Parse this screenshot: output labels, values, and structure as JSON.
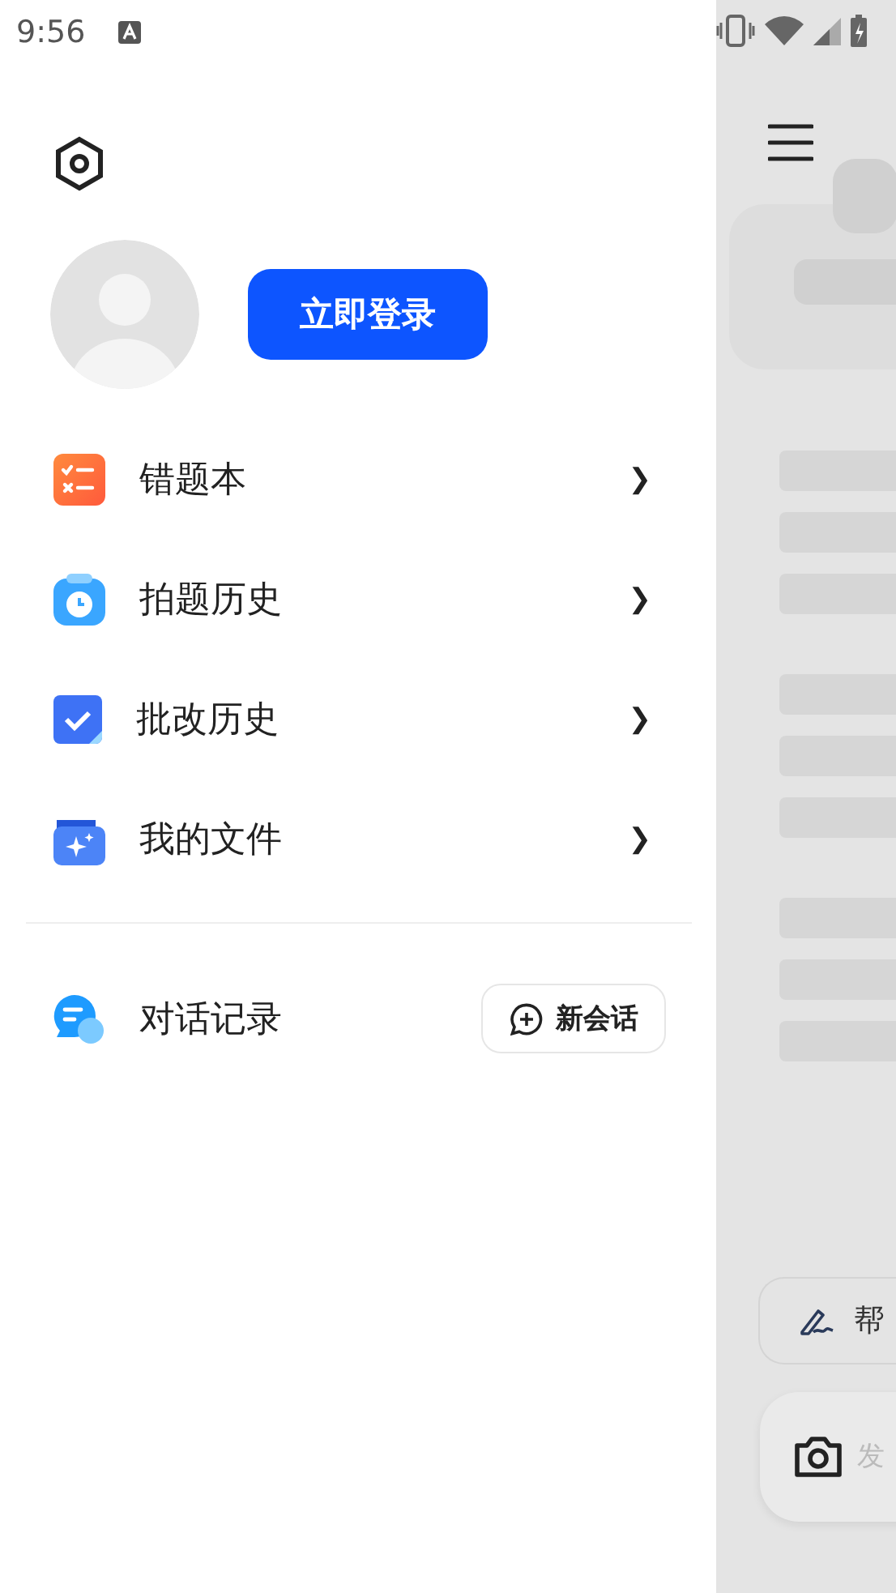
{
  "status_bar": {
    "time": "9:56"
  },
  "drawer": {
    "login_button": "立即登录",
    "menu": [
      {
        "kind": "wrong",
        "label": "错题本",
        "chevron": "❯"
      },
      {
        "kind": "photo",
        "label": "拍题历史",
        "chevron": "❯"
      },
      {
        "kind": "check",
        "label": "批改历史",
        "chevron": "❯"
      },
      {
        "kind": "files",
        "label": "我的文件",
        "chevron": "❯"
      }
    ],
    "chat_history": {
      "label": "对话记录",
      "new_chat_button": "新会话"
    }
  },
  "main": {
    "chip": "帮",
    "input": {
      "placeholder": "发"
    }
  }
}
